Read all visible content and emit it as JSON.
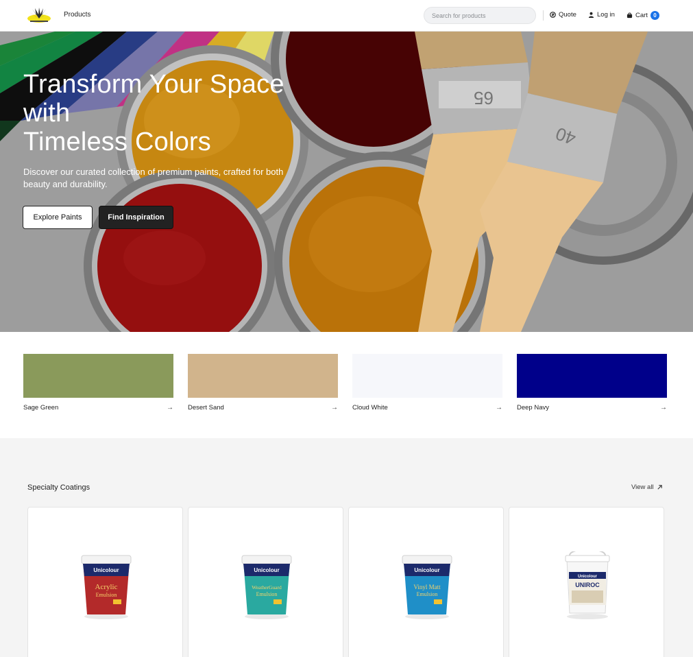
{
  "header": {
    "nav_products": "Products",
    "search_placeholder": "Search for products",
    "quote": "Quote",
    "login": "Log in",
    "cart": "Cart",
    "cart_count": "0"
  },
  "hero": {
    "title_line1": "Transform Your Space",
    "title_line2": "with",
    "title_line3": "Timeless Colors",
    "subtitle": "Discover our curated collection of premium paints, crafted for both beauty and durability.",
    "btn_explore": "Explore Paints",
    "btn_inspire": "Find Inspiration",
    "brush_numbers": [
      "65",
      "40"
    ]
  },
  "swatches": [
    {
      "name": "Sage Green",
      "color": "#8a9a5b"
    },
    {
      "name": "Desert Sand",
      "color": "#d1b48c"
    },
    {
      "name": "Cloud White",
      "color": "#f6f7fb"
    },
    {
      "name": "Deep Navy",
      "color": "#00008a"
    }
  ],
  "specialty": {
    "title": "Specialty Coatings",
    "view_all": "View all",
    "products": [
      {
        "brand": "Unicolour",
        "name": "Acrylic",
        "sub": "Emulsion",
        "label_color": "#b02a2a"
      },
      {
        "brand": "Unicolour",
        "name": "WeatherGuard",
        "sub": "Emulsion",
        "label_color": "#2aa9a0"
      },
      {
        "brand": "Unicolour",
        "name": "Vinyl Matt",
        "sub": "Emulsion",
        "label_color": "#1f8fc8"
      },
      {
        "brand": "Unicolour",
        "name": "UNIROC",
        "sub": "",
        "label_color": "#f1ede3"
      }
    ]
  },
  "icons": {
    "quote": "quote-icon",
    "login": "user-icon",
    "cart": "cart-icon",
    "arrow": "arrow-right-icon",
    "view_all": "arrow-up-right-icon"
  }
}
